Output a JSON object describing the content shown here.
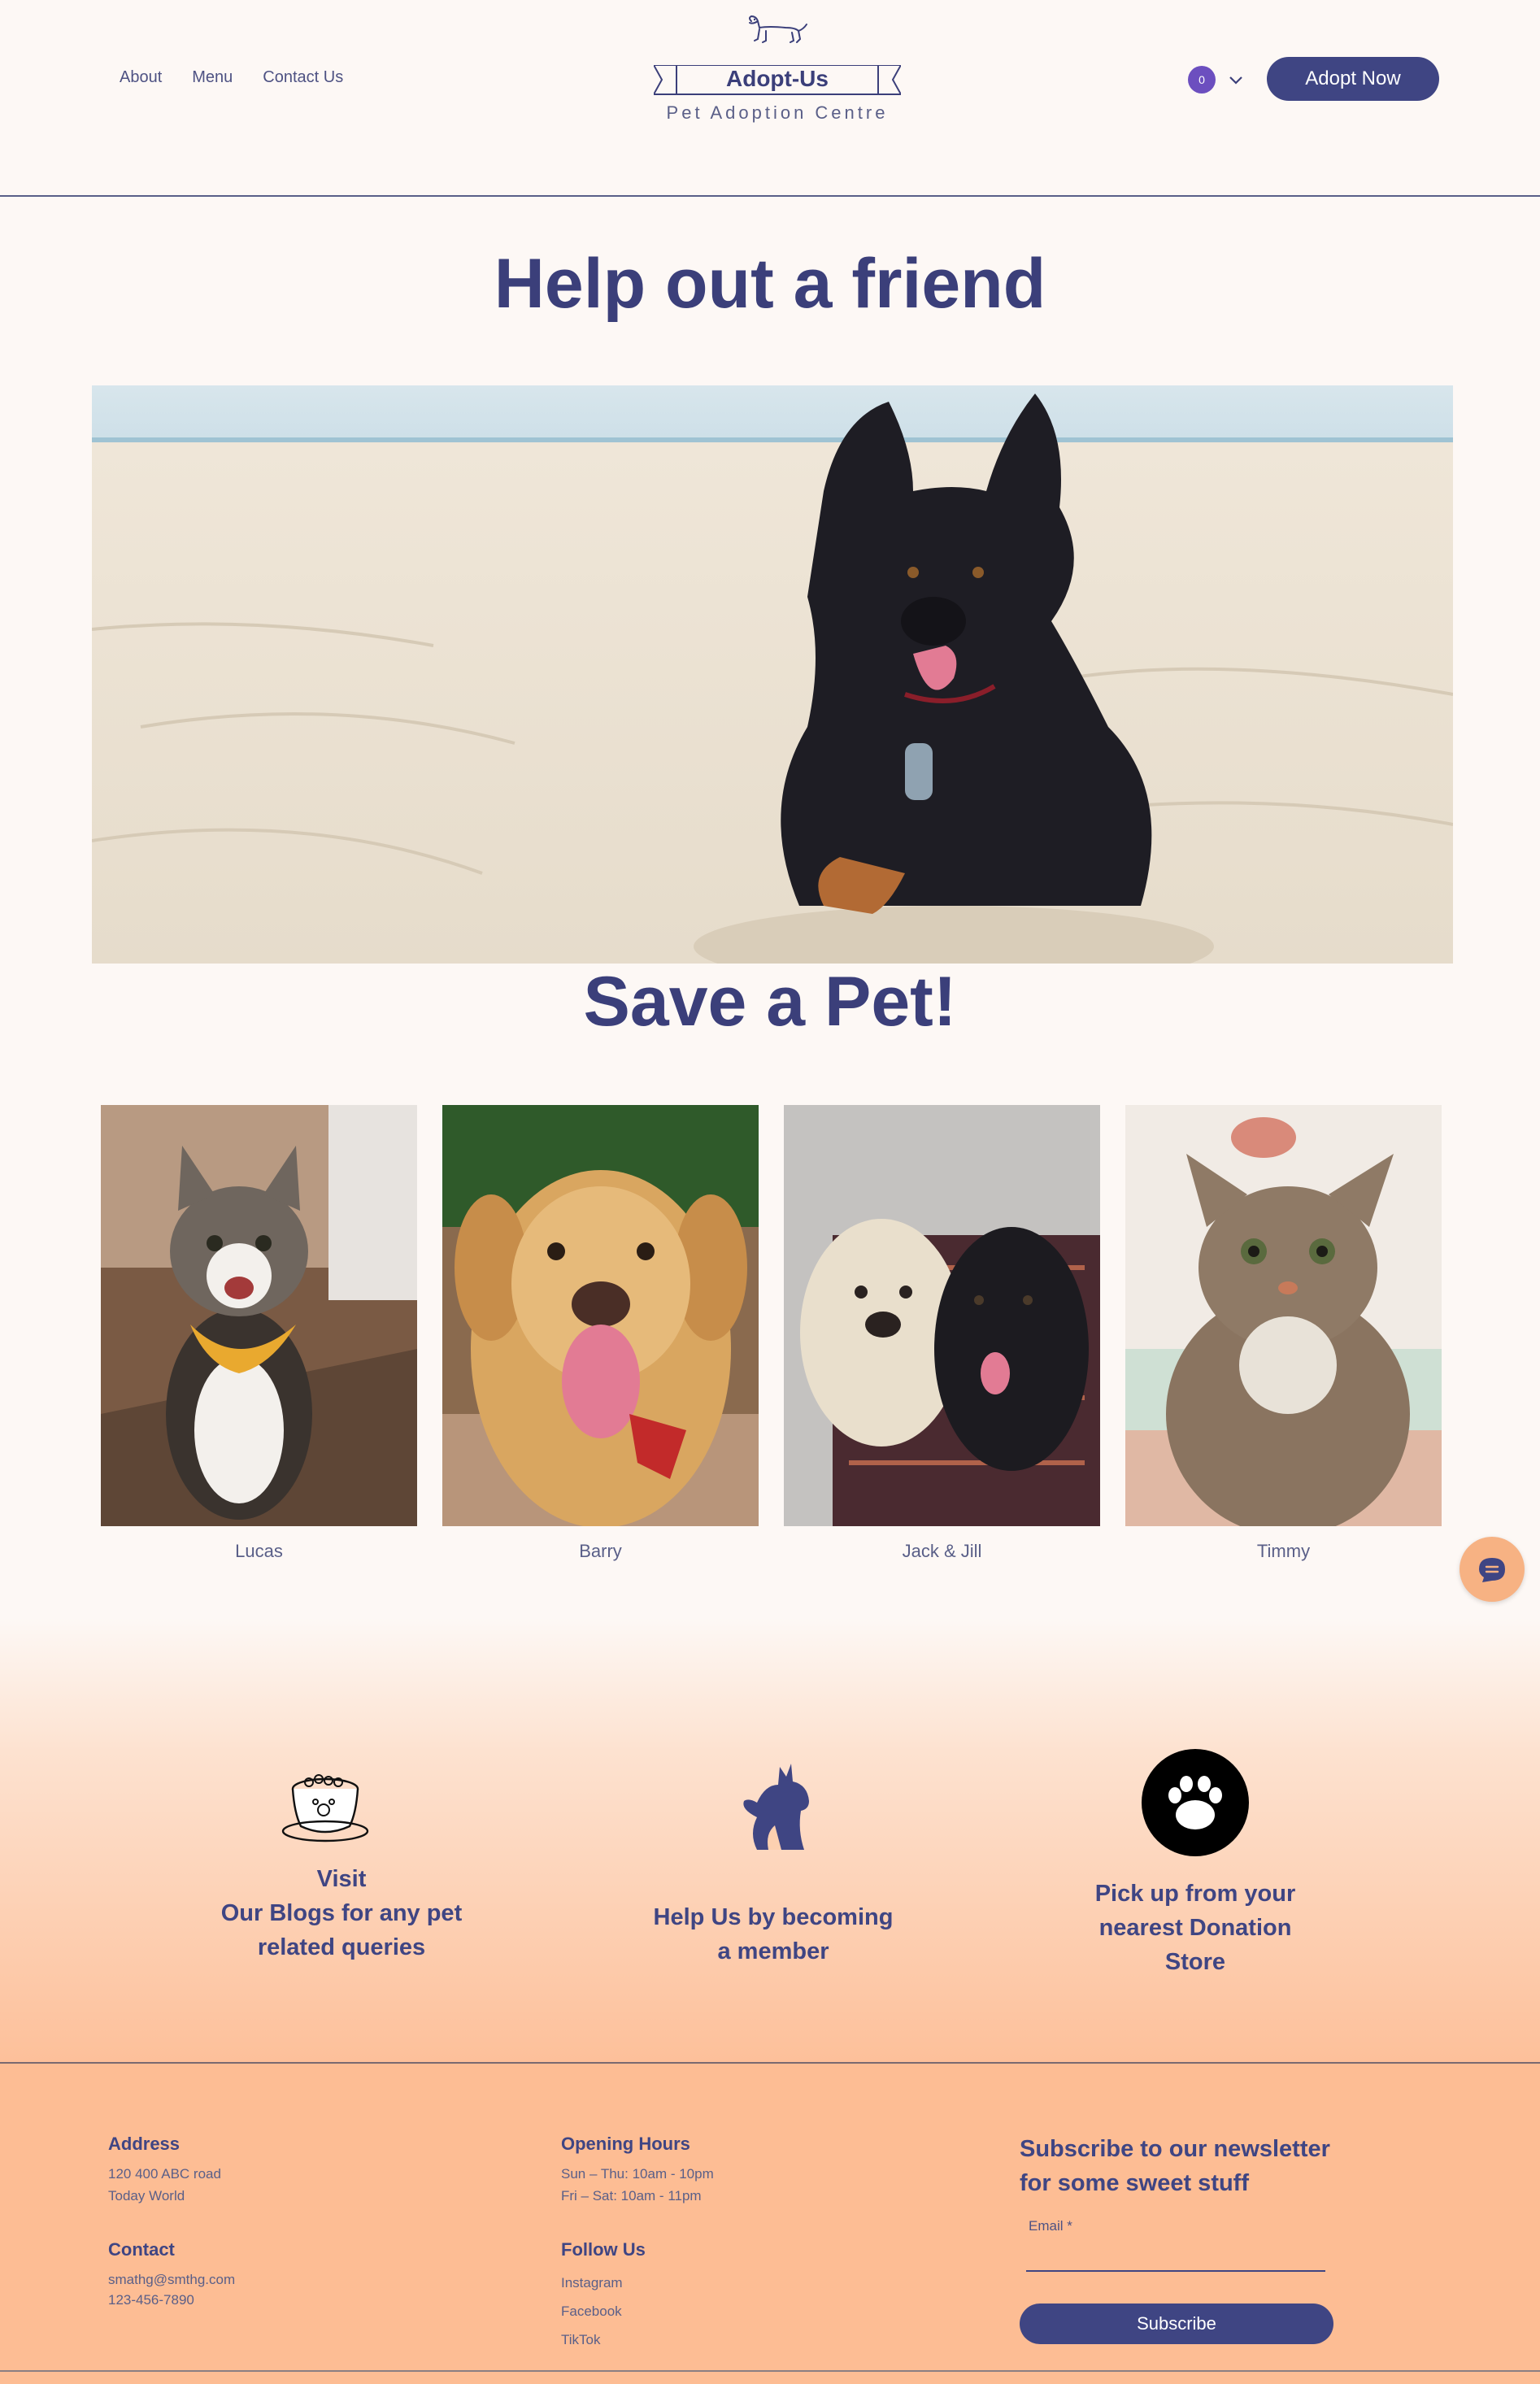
{
  "nav": {
    "about": "About",
    "menu": "Menu",
    "contact": "Contact Us"
  },
  "logo": {
    "title": "Adopt-Us",
    "subtitle": "Pet Adoption Centre"
  },
  "header": {
    "cart_count": "0",
    "adopt_button": "Adopt Now"
  },
  "hero": {
    "title": "Help out a friend",
    "title2": "Save a Pet!"
  },
  "pets": [
    {
      "name": "Lucas"
    },
    {
      "name": "Barry"
    },
    {
      "name": "Jack & Jill"
    },
    {
      "name": "Timmy"
    }
  ],
  "features": {
    "blogs": {
      "line1": "Visit",
      "line2": "Our Blogs for any pet",
      "line3": "related queries"
    },
    "member": {
      "line1": "Help Us by becoming",
      "line2": "a member"
    },
    "donation": {
      "line1": "Pick up from your",
      "line2": "nearest Donation",
      "line3": "Store"
    }
  },
  "footer": {
    "address_title": "Address",
    "address_line1": "120 400 ABC road",
    "address_line2": "Today World",
    "contact_title": "Contact",
    "contact_email": "smathg@smthg.com",
    "contact_phone": "123-456-7890",
    "hours_title": "Opening Hours",
    "hours_line1": "Sun – Thu: 10am - 10pm",
    "hours_line2": "Fri – Sat: 10am - 11pm",
    "follow_title": "Follow Us",
    "social": [
      "Instagram",
      "Facebook",
      "TikTok"
    ],
    "newsletter_line1": "Subscribe to our newsletter",
    "newsletter_line2": "for some sweet stuff",
    "email_label": "Email *",
    "subscribe_button": "Subscribe"
  },
  "colors": {
    "accent": "#3f4583",
    "badge": "#6c4fbf",
    "peach": "#fdbd94",
    "background": "#fdf8f5"
  }
}
